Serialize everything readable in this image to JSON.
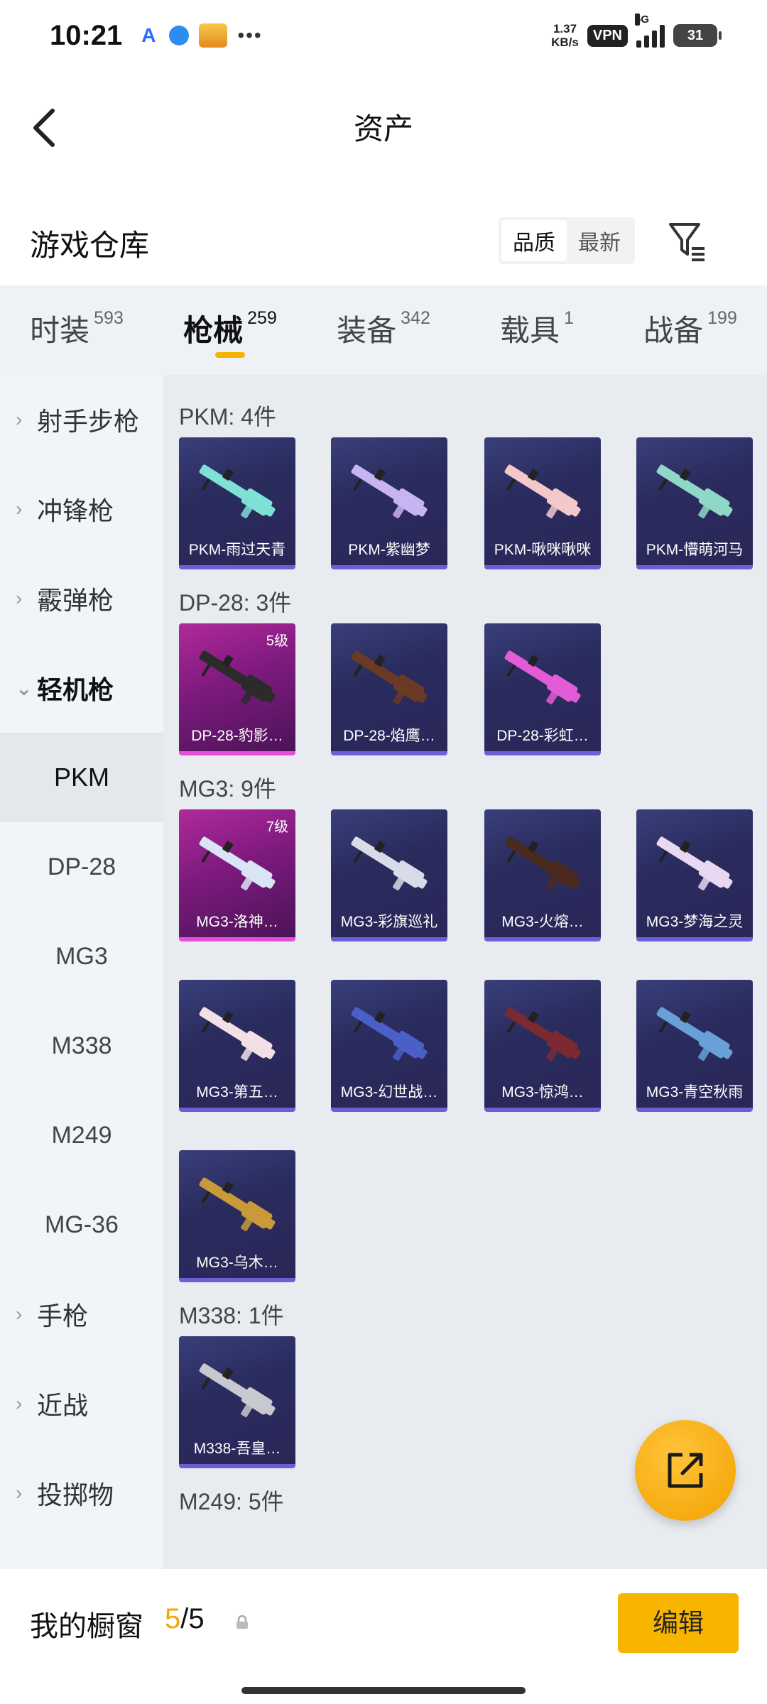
{
  "status_bar": {
    "time": "10:21",
    "net_speed_value": "1.37",
    "net_speed_unit": "KB/s",
    "vpn": "VPN",
    "network": "5G",
    "battery": "31"
  },
  "header": {
    "title": "资产"
  },
  "warehouse": {
    "label": "游戏仓库",
    "sort_options": [
      "品质",
      "最新"
    ],
    "sort_selected": "品质"
  },
  "tabs": [
    {
      "label": "时装",
      "count": "593"
    },
    {
      "label": "枪械",
      "count": "259",
      "active": true
    },
    {
      "label": "装备",
      "count": "342"
    },
    {
      "label": "载具",
      "count": "1"
    },
    {
      "label": "战备",
      "count": "199"
    }
  ],
  "sidebar": {
    "categories": [
      {
        "label": "射手步枪"
      },
      {
        "label": "冲锋枪"
      },
      {
        "label": "霰弹枪"
      },
      {
        "label": "轻机枪",
        "open": true
      }
    ],
    "sub_items": [
      {
        "label": "PKM",
        "selected": true
      },
      {
        "label": "DP-28"
      },
      {
        "label": "MG3"
      },
      {
        "label": "M338"
      },
      {
        "label": "M249"
      },
      {
        "label": "MG-36"
      }
    ],
    "more_categories": [
      {
        "label": "手枪"
      },
      {
        "label": "近战"
      },
      {
        "label": "投掷物"
      }
    ]
  },
  "groups": [
    {
      "title": "PKM: 4件",
      "items": [
        {
          "name": "PKM-雨过天青",
          "tone": "blue",
          "gun_color": "#7fe0d6"
        },
        {
          "name": "PKM-紫幽梦",
          "tone": "blue",
          "gun_color": "#c8b4f0"
        },
        {
          "name": "PKM-啾咪啾咪",
          "tone": "blue",
          "gun_color": "#f4c7c9"
        },
        {
          "name": "PKM-懵萌河马",
          "tone": "blue",
          "gun_color": "#8fd8c8"
        }
      ]
    },
    {
      "title": "DP-28: 3件",
      "items": [
        {
          "name": "DP-28-豹影…",
          "tone": "pink",
          "level": "5级",
          "gun_color": "#2b2b2b"
        },
        {
          "name": "DP-28-焰鹰…",
          "tone": "blue",
          "gun_color": "#6b3a24"
        },
        {
          "name": "DP-28-彩虹…",
          "tone": "blue",
          "gun_color": "#e45bd8"
        }
      ]
    },
    {
      "title": "MG3: 9件",
      "items": [
        {
          "name": "MG3-洛神…",
          "tone": "pink",
          "level": "7级",
          "gun_color": "#d9e4f5"
        },
        {
          "name": "MG3-彩旗巡礼",
          "tone": "blue",
          "gun_color": "#d8dce8"
        },
        {
          "name": "MG3-火熔…",
          "tone": "blue",
          "gun_color": "#4a2a1e"
        },
        {
          "name": "MG3-梦海之灵",
          "tone": "blue",
          "gun_color": "#e8d8f2"
        },
        {
          "name": "MG3-第五…",
          "tone": "blue",
          "gun_color": "#f3dfe6"
        },
        {
          "name": "MG3-幻世战…",
          "tone": "blue",
          "gun_color": "#4a5fc8"
        },
        {
          "name": "MG3-惊鸿…",
          "tone": "blue",
          "gun_color": "#7a2a30"
        },
        {
          "name": "MG3-青空秋雨",
          "tone": "blue",
          "gun_color": "#6aa0d8"
        },
        {
          "name": "MG3-乌木…",
          "tone": "blue",
          "gun_color": "#c89a3a"
        }
      ]
    },
    {
      "title": "M338: 1件",
      "items": [
        {
          "name": "M338-吾皇…",
          "tone": "blue",
          "gun_color": "#c8c8d0"
        }
      ]
    },
    {
      "title": "M249: 5件",
      "items": []
    }
  ],
  "bottom_bar": {
    "label": "我的橱窗",
    "count_current": "5",
    "count_total": "/5",
    "edit_label": "编辑"
  }
}
